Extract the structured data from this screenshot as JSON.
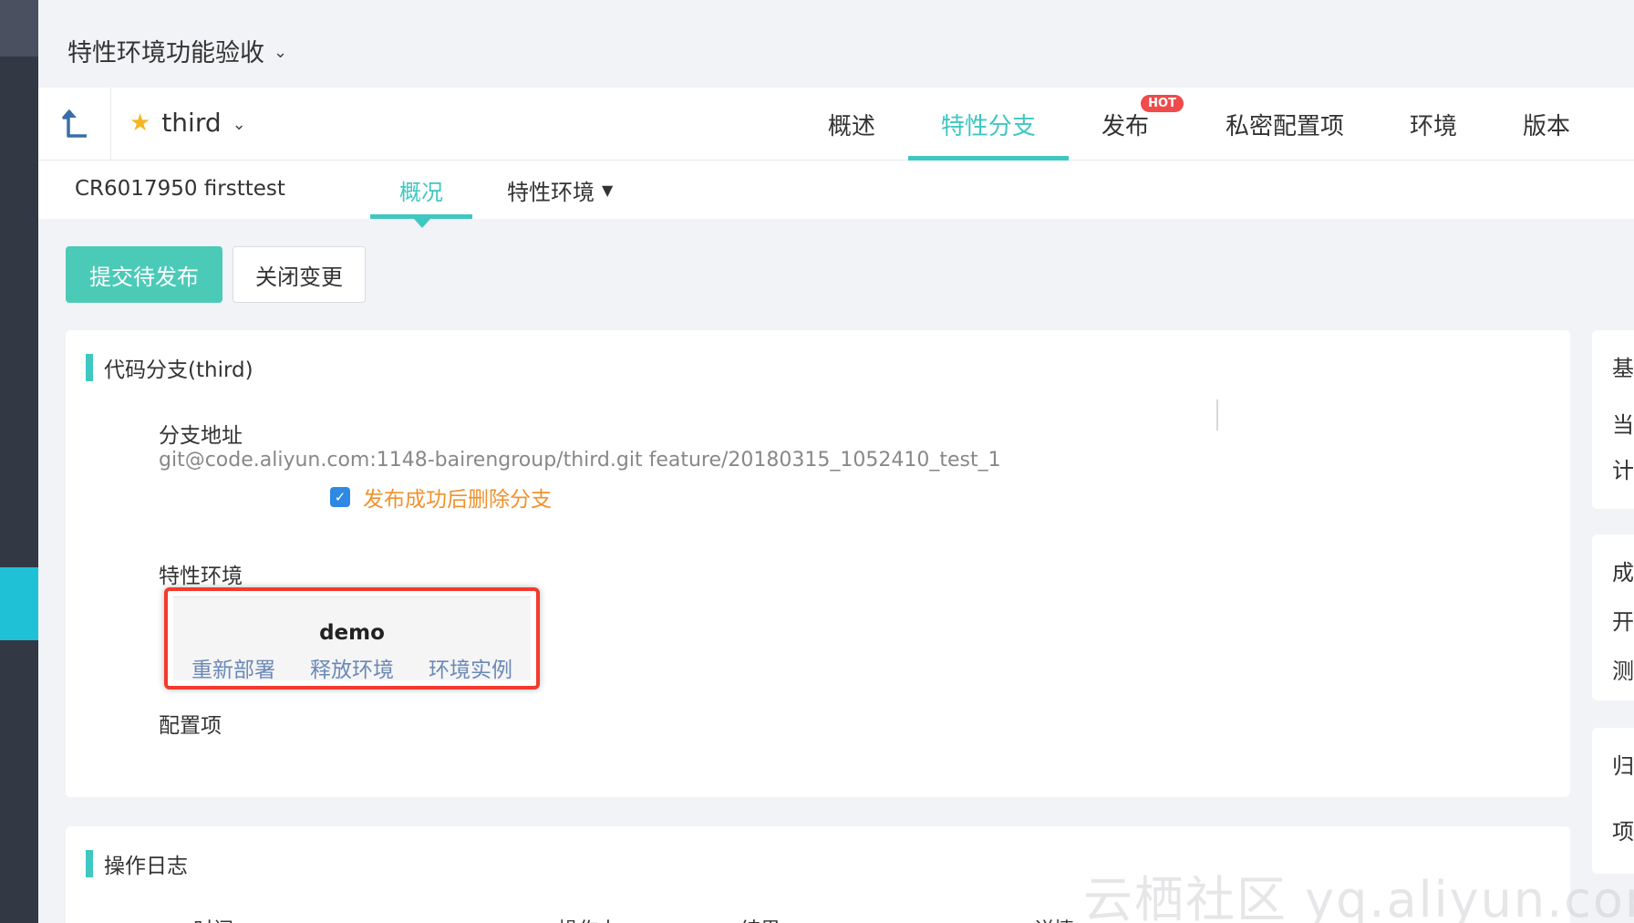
{
  "project": {
    "title": "特性环境功能验收"
  },
  "app": {
    "name": "third"
  },
  "nav": {
    "tabs": [
      {
        "label": "概述"
      },
      {
        "label": "特性分支"
      },
      {
        "label": "发布",
        "badge": "HOT"
      },
      {
        "label": "私密配置项"
      },
      {
        "label": "环境"
      },
      {
        "label": "版本"
      }
    ],
    "active": "特性分支"
  },
  "subnav": {
    "cr": "CR6017950 firsttest",
    "overview": "概况",
    "feature_env": "特性环境"
  },
  "actions": {
    "submit": "提交待发布",
    "close": "关闭变更"
  },
  "branch_card": {
    "title": "代码分支(third)",
    "branch_label": "分支地址",
    "branch_url": "git@code.aliyun.com:1148-bairengroup/third.git feature/20180315_1052410_test_1",
    "delete_branch_label": "发布成功后删除分支",
    "delete_branch_checked": true,
    "feature_env_label": "特性环境",
    "env": {
      "name": "demo",
      "actions": [
        "重新部署",
        "释放环境",
        "环境实例"
      ]
    },
    "config_label": "配置项"
  },
  "log_card": {
    "title": "操作日志",
    "headers": [
      "时间",
      "操作人",
      "结果",
      "详情"
    ]
  },
  "right_panel": {
    "card1": [
      "基",
      "当",
      "计"
    ],
    "card2": [
      "成",
      "开",
      "测"
    ],
    "card3": [
      "归",
      "项"
    ]
  },
  "watermark": "云栖社区 yq.aliyun.com",
  "colors": {
    "accent": "#3fc7c2",
    "primary_button": "#4ccab8",
    "highlight_border": "#f33a2e",
    "link": "#6b89b5",
    "warning_text": "#f0922d"
  }
}
